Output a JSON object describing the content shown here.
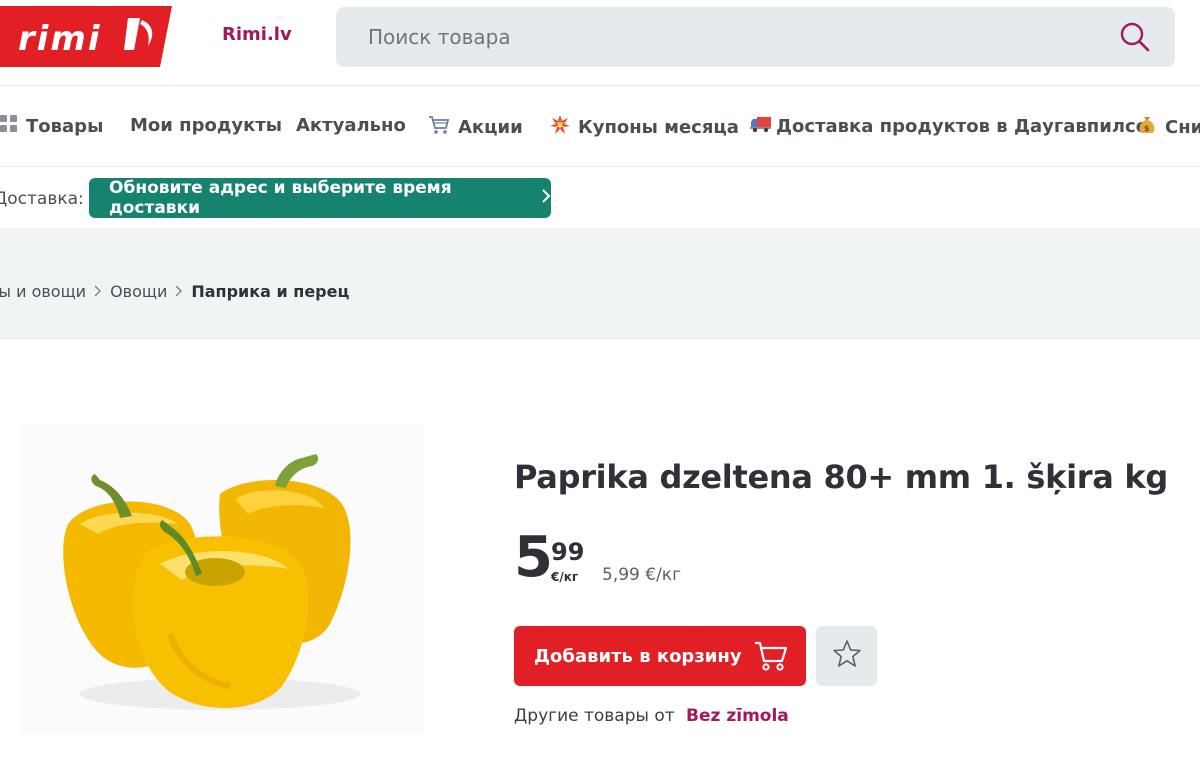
{
  "header": {
    "logo_text": "RIMI",
    "site_link": "Rimi.lv",
    "search_placeholder": "Поиск товара",
    "search_icon": "search-icon"
  },
  "nav": {
    "items": [
      {
        "label": "Товары",
        "icon": "grid-icon",
        "glyph": "▦"
      },
      {
        "label": "Мои продукты",
        "icon": "",
        "glyph": ""
      },
      {
        "label": "Актуально",
        "icon": "",
        "glyph": ""
      },
      {
        "label": "Акции",
        "icon": "shopping-cart-icon",
        "glyph": "🛒"
      },
      {
        "label": "Купоны месяца",
        "icon": "collision-icon",
        "glyph": "💥"
      },
      {
        "label": "Доставка продуктов в Даугавпилсе",
        "icon": "delivery-truck-icon",
        "glyph": "🚚"
      },
      {
        "label": "Сни",
        "icon": "money-bag-icon",
        "glyph": "💰"
      }
    ]
  },
  "delivery": {
    "label": "Доставка:",
    "button_label": "Обновите адрес и выберите время доставки",
    "chevron": "›"
  },
  "breadcrumbs": {
    "items": [
      "Фрукты и овощи",
      "Овощи",
      "Паприка и перец"
    ],
    "separator": "›"
  },
  "product": {
    "title": "Paprika dzeltena 80+ mm 1. šķira kg",
    "price_int": "5",
    "price_dec": "99",
    "price_unit": "€/кг",
    "price_per_unit": "5,99 €/кг",
    "add_to_cart_label": "Добавить в корзину",
    "brand_prefix": "Другие товары от",
    "brand_name": "Bez zīmola"
  },
  "colors": {
    "brand_red": "#e31f26",
    "brand_purple": "#a1185c",
    "delivery_green": "#15836e",
    "search_bg": "#e5eaed"
  }
}
